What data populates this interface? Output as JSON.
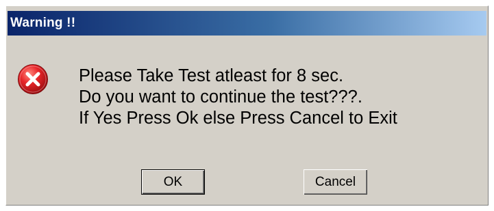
{
  "window": {
    "title": "Warning !!",
    "accent_color": "#0a246a",
    "background_color": "#d4d0c8"
  },
  "icon": {
    "name": "error-icon",
    "color": "#e8262a"
  },
  "message": {
    "lines": [
      "Please Take Test atleast for 8 sec.",
      "Do you want to continue the test???.",
      "If Yes Press Ok else Press Cancel to Exit"
    ]
  },
  "buttons": {
    "ok_label": "OK",
    "cancel_label": "Cancel"
  }
}
